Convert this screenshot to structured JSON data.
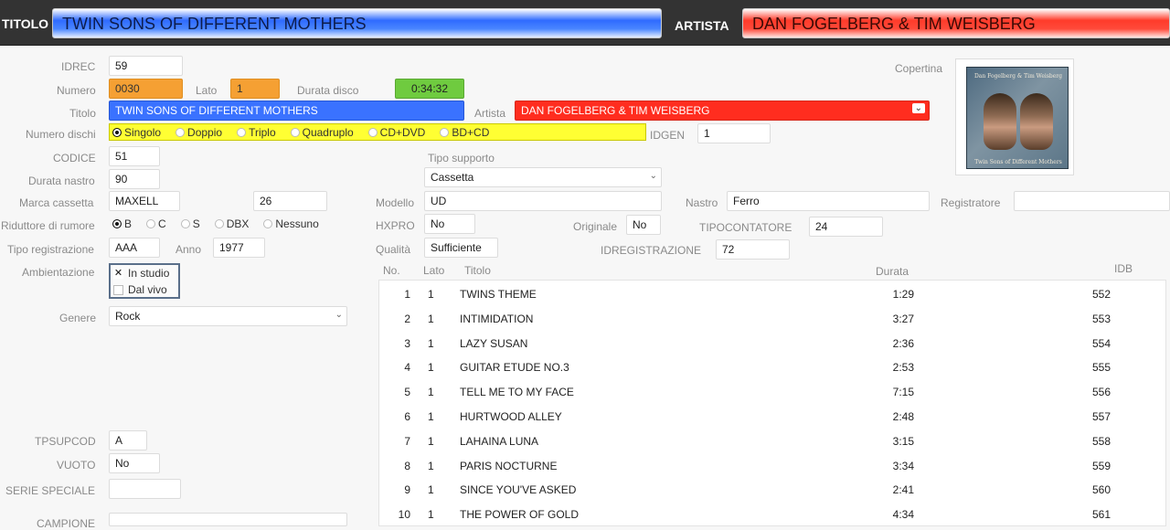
{
  "header": {
    "title_label": "TITOLO",
    "title_value": "TWIN SONS OF DIFFERENT MOTHERS",
    "artist_label": "ARTISTA",
    "artist_value": "DAN FOGELBERG & TIM WEISBERG"
  },
  "form": {
    "idrec_label": "IDREC",
    "idrec": "59",
    "numero_label": "Numero",
    "numero": "0030",
    "lato_label": "Lato",
    "lato": "1",
    "durata_disco_label": "Durata disco",
    "durata_disco": "0:34:32",
    "titolo_label": "Titolo",
    "titolo": "TWIN SONS OF DIFFERENT MOTHERS",
    "artista_label": "Artista",
    "artista": "DAN FOGELBERG & TIM WEISBERG",
    "numero_dischi_label": "Numero dischi",
    "numero_dischi_options": [
      "Singolo",
      "Doppio",
      "Triplo",
      "Quadruplo",
      "CD+DVD",
      "BD+CD"
    ],
    "numero_dischi_selected": "Singolo",
    "idgen_label": "IDGEN",
    "idgen": "1",
    "codice_label": "CODICE",
    "codice": "51",
    "tipo_supporto_label": "Tipo supporto",
    "tipo_supporto": "Cassetta",
    "durata_nastro_label": "Durata nastro",
    "durata_nastro": "90",
    "marca_cassetta_label": "Marca cassetta",
    "marca_cassetta": "MAXELL",
    "marca_extra": "26",
    "modello_label": "Modello",
    "modello": "UD",
    "nastro_label": "Nastro",
    "nastro": "Ferro",
    "registratore_label": "Registratore",
    "registratore": "",
    "riduttore_label": "Riduttore di rumore",
    "riduttore_options": [
      "B",
      "C",
      "S",
      "DBX",
      "Nessuno"
    ],
    "riduttore_selected": "B",
    "hxpro_label": "HXPRO",
    "hxpro": "No",
    "originale_label": "Originale",
    "originale": "No",
    "tipocontatore_label": "TIPOCONTATORE",
    "tipocontatore": "24",
    "tipo_registrazione_label": "Tipo registrazione",
    "tipo_registrazione": "AAA",
    "anno_label": "Anno",
    "anno": "1977",
    "qualita_label": "Qualità",
    "qualita": "Sufficiente",
    "idregistrazione_label": "IDREGISTRAZIONE",
    "idregistrazione": "72",
    "ambientazione_label": "Ambientazione",
    "ambientazione_options": [
      {
        "label": "In studio",
        "checked": true
      },
      {
        "label": "Dal vivo",
        "checked": false
      }
    ],
    "genere_label": "Genere",
    "genere": "Rock",
    "tpsupcod_label": "TPSUPCOD",
    "tpsupcod": "A",
    "vuoto_label": "VUOTO",
    "vuoto": "No",
    "serie_speciale_label": "SERIE SPECIALE",
    "serie_speciale": "",
    "campione_label": "CAMPIONE",
    "campione": "",
    "copertina_label": "Copertina"
  },
  "cover": {
    "top_text": "Dan Fogelberg & Tim Weisberg",
    "bottom_text": "Twin Sons of Different Mothers"
  },
  "tracks": {
    "headers": {
      "no": "No.",
      "lato": "Lato",
      "titolo": "Titolo",
      "durata": "Durata",
      "idb": "IDB"
    },
    "rows": [
      {
        "no": "1",
        "lato": "1",
        "titolo": "TWINS THEME",
        "durata": "1:29",
        "idb": "552"
      },
      {
        "no": "2",
        "lato": "1",
        "titolo": "INTIMIDATION",
        "durata": "3:27",
        "idb": "553"
      },
      {
        "no": "3",
        "lato": "1",
        "titolo": "LAZY SUSAN",
        "durata": "2:36",
        "idb": "554"
      },
      {
        "no": "4",
        "lato": "1",
        "titolo": "GUITAR ETUDE NO.3",
        "durata": "2:53",
        "idb": "555"
      },
      {
        "no": "5",
        "lato": "1",
        "titolo": "TELL ME TO MY FACE",
        "durata": "7:15",
        "idb": "556"
      },
      {
        "no": "6",
        "lato": "1",
        "titolo": "HURTWOOD ALLEY",
        "durata": "2:48",
        "idb": "557"
      },
      {
        "no": "7",
        "lato": "1",
        "titolo": "LAHAINA LUNA",
        "durata": "3:15",
        "idb": "558"
      },
      {
        "no": "8",
        "lato": "1",
        "titolo": "PARIS NOCTURNE",
        "durata": "3:34",
        "idb": "559"
      },
      {
        "no": "9",
        "lato": "1",
        "titolo": "SINCE YOU'VE ASKED",
        "durata": "2:41",
        "idb": "560"
      },
      {
        "no": "10",
        "lato": "1",
        "titolo": "THE POWER OF GOLD",
        "durata": "4:34",
        "idb": "561"
      }
    ]
  },
  "colors": {
    "header_bg": "#333333",
    "title_blue": "#2f6bff",
    "artist_red": "#ff3b2a",
    "numero_orange": "#f5a033",
    "durata_green": "#6fcb3f",
    "dischi_yellow": "#ffff33"
  }
}
